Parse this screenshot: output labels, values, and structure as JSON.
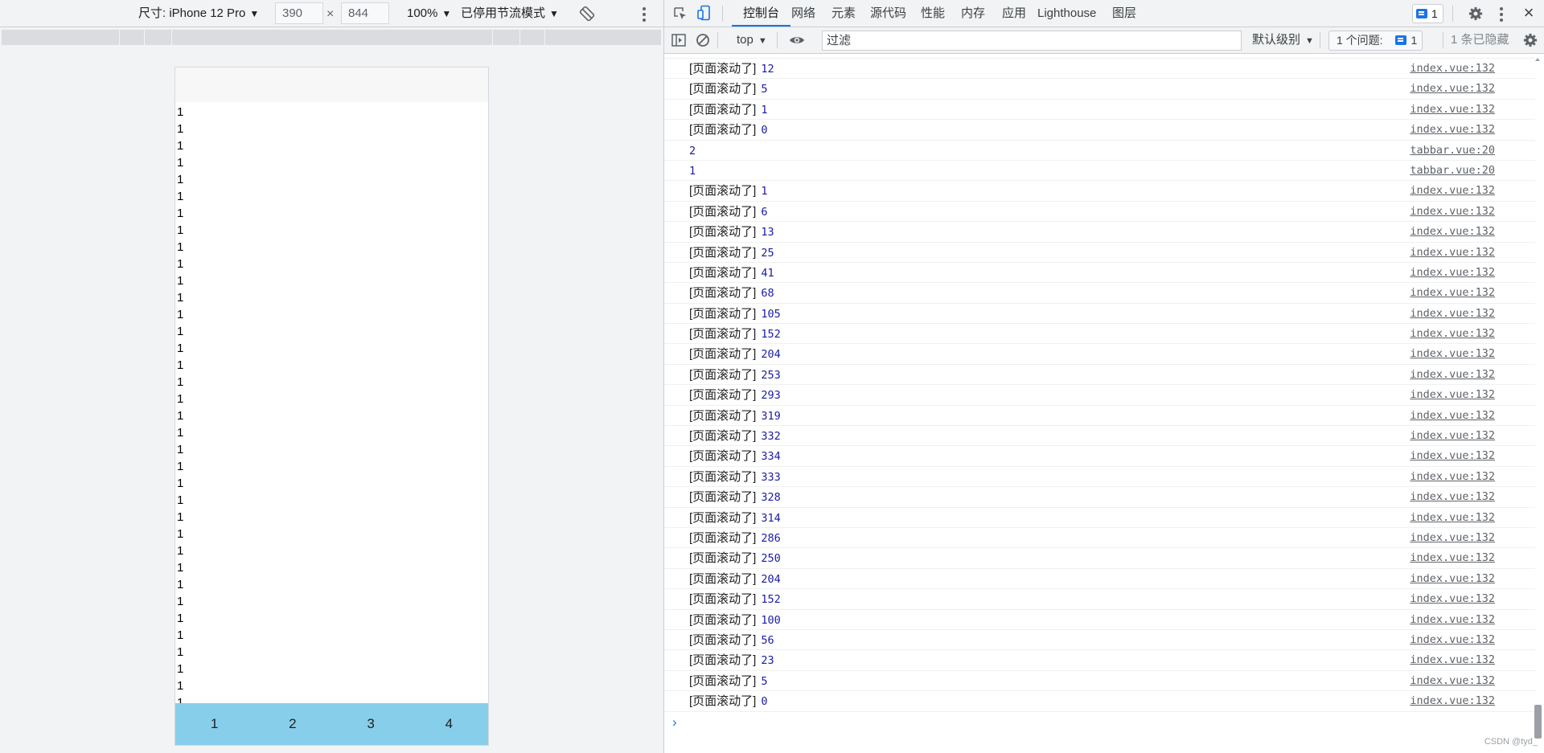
{
  "device_toolbar": {
    "dimensions_label": "尺寸: iPhone 12 Pro",
    "width_value": "390",
    "times_sign": "×",
    "height_value": "844",
    "zoom": "100%",
    "throttle": "已停用节流模式",
    "caret": "▼"
  },
  "phone": {
    "list_items": [
      "1",
      "1",
      "1",
      "1",
      "1",
      "1",
      "1",
      "1",
      "1",
      "1",
      "1",
      "1",
      "1",
      "1",
      "1",
      "1",
      "1",
      "1",
      "1",
      "1",
      "1",
      "1",
      "1",
      "1",
      "1",
      "1",
      "1",
      "1",
      "1",
      "1",
      "1",
      "1",
      "1",
      "1",
      "1",
      "1",
      "1"
    ],
    "tabbar": [
      "1",
      "2",
      "3",
      "4"
    ],
    "tabbar_color": "#87ceeb"
  },
  "devtools": {
    "tabs": [
      "控制台",
      "网络",
      "元素",
      "源代码",
      "性能",
      "内存",
      "应用",
      "Lighthouse",
      "图层"
    ],
    "active_tab": "控制台",
    "issue_count": "1",
    "accent": "#1a73e8"
  },
  "console_toolbar": {
    "context": "top",
    "filter_placeholder": "过滤",
    "log_level": "默认级别",
    "issues_label": "1 个问题:",
    "issues_count": "1",
    "hidden_count": "1 条已隐藏"
  },
  "console_logs": [
    {
      "msg": "[页面滚动了]",
      "value": "12",
      "source": "index.vue:132"
    },
    {
      "msg": "[页面滚动了]",
      "value": "5",
      "source": "index.vue:132"
    },
    {
      "msg": "[页面滚动了]",
      "value": "1",
      "source": "index.vue:132"
    },
    {
      "msg": "[页面滚动了]",
      "value": "0",
      "source": "index.vue:132"
    },
    {
      "msg": "",
      "value": "2",
      "source": "tabbar.vue:20"
    },
    {
      "msg": "",
      "value": "1",
      "source": "tabbar.vue:20"
    },
    {
      "msg": "[页面滚动了]",
      "value": "1",
      "source": "index.vue:132"
    },
    {
      "msg": "[页面滚动了]",
      "value": "6",
      "source": "index.vue:132"
    },
    {
      "msg": "[页面滚动了]",
      "value": "13",
      "source": "index.vue:132"
    },
    {
      "msg": "[页面滚动了]",
      "value": "25",
      "source": "index.vue:132"
    },
    {
      "msg": "[页面滚动了]",
      "value": "41",
      "source": "index.vue:132"
    },
    {
      "msg": "[页面滚动了]",
      "value": "68",
      "source": "index.vue:132"
    },
    {
      "msg": "[页面滚动了]",
      "value": "105",
      "source": "index.vue:132"
    },
    {
      "msg": "[页面滚动了]",
      "value": "152",
      "source": "index.vue:132"
    },
    {
      "msg": "[页面滚动了]",
      "value": "204",
      "source": "index.vue:132"
    },
    {
      "msg": "[页面滚动了]",
      "value": "253",
      "source": "index.vue:132"
    },
    {
      "msg": "[页面滚动了]",
      "value": "293",
      "source": "index.vue:132"
    },
    {
      "msg": "[页面滚动了]",
      "value": "319",
      "source": "index.vue:132"
    },
    {
      "msg": "[页面滚动了]",
      "value": "332",
      "source": "index.vue:132"
    },
    {
      "msg": "[页面滚动了]",
      "value": "334",
      "source": "index.vue:132"
    },
    {
      "msg": "[页面滚动了]",
      "value": "333",
      "source": "index.vue:132"
    },
    {
      "msg": "[页面滚动了]",
      "value": "328",
      "source": "index.vue:132"
    },
    {
      "msg": "[页面滚动了]",
      "value": "314",
      "source": "index.vue:132"
    },
    {
      "msg": "[页面滚动了]",
      "value": "286",
      "source": "index.vue:132"
    },
    {
      "msg": "[页面滚动了]",
      "value": "250",
      "source": "index.vue:132"
    },
    {
      "msg": "[页面滚动了]",
      "value": "204",
      "source": "index.vue:132"
    },
    {
      "msg": "[页面滚动了]",
      "value": "152",
      "source": "index.vue:132"
    },
    {
      "msg": "[页面滚动了]",
      "value": "100",
      "source": "index.vue:132"
    },
    {
      "msg": "[页面滚动了]",
      "value": "56",
      "source": "index.vue:132"
    },
    {
      "msg": "[页面滚动了]",
      "value": "23",
      "source": "index.vue:132"
    },
    {
      "msg": "[页面滚动了]",
      "value": "5",
      "source": "index.vue:132"
    },
    {
      "msg": "[页面滚动了]",
      "value": "0",
      "source": "index.vue:132"
    }
  ],
  "prompt_symbol": "›",
  "watermark": "CSDN @tyd_"
}
